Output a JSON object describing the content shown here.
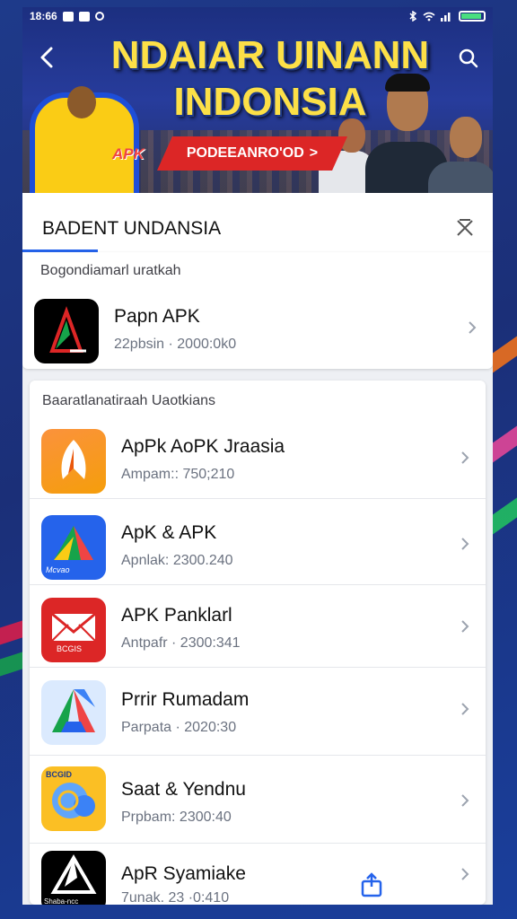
{
  "status_bar": {
    "time": "18:66"
  },
  "banner": {
    "headline": "NDAIAR UINANN INDONSIA",
    "apk_tag": "APK",
    "promo_label": "PODEEANRO'OD",
    "promo_arrow": ">"
  },
  "title_bar": {
    "title": "BADENT UNDANSIA"
  },
  "featured": {
    "label": "Bogondiamarl uratkah",
    "app": {
      "name": "Papn APK",
      "meta": "22pbsin · 2000:0k0"
    }
  },
  "list": {
    "label": "Baaratlanatiraah Uaotkians",
    "items": [
      {
        "name": "ApPk AoPK Jraasia",
        "meta": "Ampam:: 750;210",
        "icon": "orange-pin-icon"
      },
      {
        "name": "ApK & APK",
        "meta": "Apnlak: 2300.240",
        "icon": "maps-triangle-icon",
        "icon_caption": "Mcvao"
      },
      {
        "name": "APK Panklarl",
        "meta": "Antpafr · 2300:341",
        "icon": "red-envelope-icon",
        "icon_caption": "BCGIS"
      },
      {
        "name": "Prrir Rumadam",
        "meta": "Parpata · 2020:30",
        "icon": "drive-triangle-icon"
      },
      {
        "name": "Saat & Yendnu",
        "meta": "Prpbam: 2300:40",
        "icon": "yellow-cloud-icon",
        "icon_caption": "BCGID"
      },
      {
        "name": "ApR Syamiake",
        "meta": "7unak. 23 ·0:410",
        "icon": "black-triangle-icon",
        "icon_caption": "Shaba-ncc"
      }
    ]
  },
  "colors": {
    "accent_blue": "#2563eb",
    "headline_yellow": "#fde047",
    "promo_red": "#dc2626"
  }
}
